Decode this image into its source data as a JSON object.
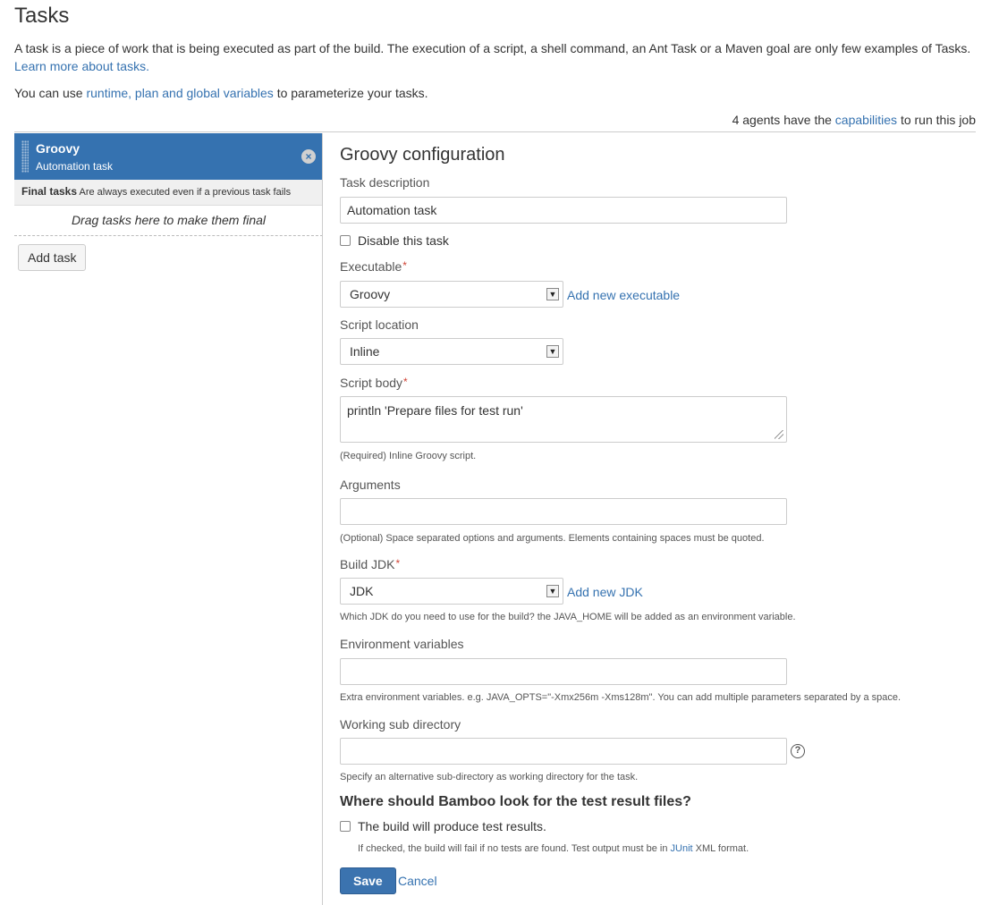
{
  "page": {
    "title": "Tasks",
    "intro_text": "A task is a piece of work that is being executed as part of the build. The execution of a script, a shell command, an Ant Task or a Maven goal are only few examples of Tasks.",
    "learn_more_link": "Learn more about tasks.",
    "variables_prefix": "You can use ",
    "variables_link": "runtime, plan and global variables",
    "variables_suffix": " to parameterize your tasks.",
    "agents_prefix": "4 agents have the ",
    "capabilities_link": "capabilities",
    "agents_suffix": " to run this job"
  },
  "task_list": {
    "tasks": [
      {
        "name": "Groovy",
        "description": "Automation task"
      }
    ],
    "final_tasks_label": "Final tasks",
    "final_tasks_note": "Are always executed even if a previous task fails",
    "drop_zone_text": "Drag tasks here to make them final",
    "add_task_label": "Add task"
  },
  "config": {
    "title": "Groovy configuration",
    "task_description_label": "Task description",
    "task_description_value": "Automation task",
    "disable_label": "Disable this task",
    "disable_checked": false,
    "executable_label": "Executable",
    "executable_value": "Groovy",
    "add_executable_link": "Add new executable",
    "script_location_label": "Script location",
    "script_location_value": "Inline",
    "script_body_label": "Script body",
    "script_body_value": "println 'Prepare files for test run'",
    "script_body_help": "(Required) Inline Groovy script.",
    "arguments_label": "Arguments",
    "arguments_value": "",
    "arguments_help": "(Optional) Space separated options and arguments. Elements containing spaces must be quoted.",
    "build_jdk_label": "Build JDK",
    "build_jdk_value": "JDK",
    "add_jdk_link": "Add new JDK",
    "build_jdk_help": "Which JDK do you need to use for the build? the JAVA_HOME will be added as an environment variable.",
    "env_label": "Environment variables",
    "env_value": "",
    "env_help": "Extra environment variables. e.g. JAVA_OPTS=\"-Xmx256m -Xms128m\". You can add multiple parameters separated by a space.",
    "working_dir_label": "Working sub directory",
    "working_dir_value": "",
    "working_dir_help": "Specify an alternative sub-directory as working directory for the task.",
    "test_results_heading": "Where should Bamboo look for the test result files?",
    "test_results_checkbox": "The build will produce test results.",
    "test_results_checked": false,
    "test_results_help_prefix": "If checked, the build will fail if no tests are found. Test output must be in ",
    "junit_link": "JUnit",
    "test_results_help_suffix": " XML format.",
    "required_marker": "*",
    "save_label": "Save",
    "cancel_label": "Cancel"
  },
  "colors": {
    "accent": "#3572b0",
    "required": "#d04437",
    "save_button": "#3b73af"
  },
  "icons": {
    "remove": "close-circle-icon",
    "help": "question-circle-icon",
    "dropdown": "chevron-down-icon"
  }
}
